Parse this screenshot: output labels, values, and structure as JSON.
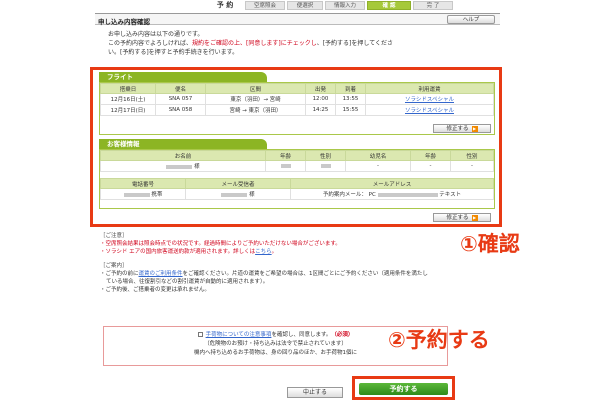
{
  "steps": {
    "label": "予 約",
    "items": [
      {
        "label": "空席照会",
        "w": 40,
        "active": false
      },
      {
        "label": "便選択",
        "w": 36,
        "active": false
      },
      {
        "label": "情報入力",
        "w": 40,
        "active": false
      },
      {
        "label": "確 認",
        "w": 44,
        "active": true
      },
      {
        "label": "完 了",
        "w": 40,
        "active": false
      }
    ]
  },
  "header": {
    "title": "申し込み内容確認",
    "help_label": "ヘルプ"
  },
  "intro": {
    "line1": "お申し込み内容は以下の通りです。",
    "line2a": "この予約内容でよろしければ、",
    "line2b": "規約をご確認の上、[同意します]にチェックし",
    "line2c": "、[予約する]を押してくださ",
    "line3": "い。[予約する]を押すと予約手続きを行います。"
  },
  "flight": {
    "title": "フライト",
    "headers": [
      "搭乗日",
      "便名",
      "区間",
      "出発",
      "到着",
      "利用運賃"
    ],
    "rows": [
      [
        "12月16日(土)",
        "SNA 057",
        "東京（羽田）→ 宮崎",
        "12:00",
        "13:55",
        "ソラシドスペシャル"
      ],
      [
        "12月17日(日)",
        "SNA 058",
        "宮崎 → 東京（羽田）",
        "14:25",
        "15:55",
        "ソラシドスペシャル"
      ]
    ],
    "edit_label": "修正する"
  },
  "customer": {
    "title": "お客様情報",
    "headers": [
      "お名前",
      "年齢",
      "性別",
      "幼児名",
      "年齢",
      "性別"
    ],
    "row": [
      "様",
      "",
      "",
      "-",
      "-",
      "-"
    ],
    "headers2": [
      "電話番号",
      "メール受信者",
      "メールアドレス"
    ],
    "phone_suffix": "携帯",
    "mail_receiver_suffix": "様",
    "mail_type": "予約案内メール：",
    "mail_device": "PC",
    "mail_format": "テキスト",
    "edit_label": "修正する"
  },
  "notes": {
    "caution_title": "［ご注意］",
    "caution1": "・空席照会結果は照会時点での状況です。経過時間によりご予約いただけない場合がございます。",
    "caution2a": "・ソラシド エアの国内旅客運送約款が適用されます。詳しくは",
    "caution2b": "こちら",
    "caution2c": "。",
    "guide_title": "［ご案内］",
    "guide1a": "・ご予約の前に",
    "guide1b": "運賃のご利用条件",
    "guide1c": "をご確認ください。片道の運賃をご希望の場合は、1区間ごとにご予約ください（適用条件を満たし",
    "guide2": "ている場合、往復割引などの割引運賃が自動的に適用されます）。",
    "guide3": "・ご予約後、ご搭乗者の変更は承れません。"
  },
  "agree": {
    "link": "手荷物についての注意事項",
    "text": "を確認し、同意します。",
    "required": "（必須）",
    "line2": "（危険物のお預け・持ち込みは法令で禁止されています）",
    "line3": "機内へ持ち込めるお手荷物は、身の回り品のほか、お手荷物1個に"
  },
  "buttons": {
    "cancel": "中止する",
    "reserve": "予約する"
  },
  "annotations": {
    "a1": "①確認",
    "a2": "②予約する"
  },
  "colors": {
    "accent_green": "#8cb524",
    "highlight_red": "#e83a14",
    "link_blue": "#3366cc"
  }
}
